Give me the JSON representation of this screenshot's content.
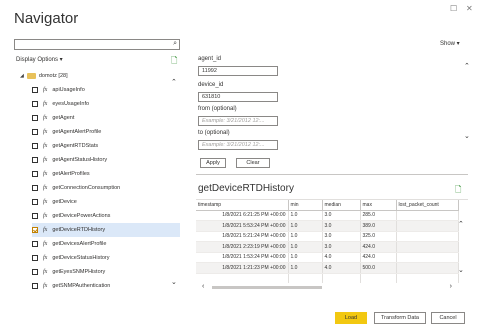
{
  "window": {
    "title": "Navigator",
    "maximize_glyph": "☐",
    "close_glyph": "✕"
  },
  "left": {
    "search": {
      "value": "",
      "placeholder": ""
    },
    "display_options": "Display Options ▾",
    "root": {
      "label": "domotz [28]",
      "icon": "folder-icon"
    },
    "items": [
      {
        "label": "apiUsageInfo",
        "checked": false
      },
      {
        "label": "eyesUsageInfo",
        "checked": false
      },
      {
        "label": "getAgent",
        "checked": false
      },
      {
        "label": "getAgentAlertProfile",
        "checked": false
      },
      {
        "label": "getAgentRTDStats",
        "checked": false
      },
      {
        "label": "getAgentStatusHistory",
        "checked": false
      },
      {
        "label": "getAlertProfiles",
        "checked": false
      },
      {
        "label": "getConnectionConsumption",
        "checked": false
      },
      {
        "label": "getDevice",
        "checked": false
      },
      {
        "label": "getDevicePowerActions",
        "checked": false
      },
      {
        "label": "getDeviceRTDHistory",
        "checked": true
      },
      {
        "label": "getDevicesAlertProfile",
        "checked": false
      },
      {
        "label": "getDeviceStatusHistory",
        "checked": false
      },
      {
        "label": "getEyesSNMPHistory",
        "checked": false
      },
      {
        "label": "getSNMPAuthentication",
        "checked": false
      }
    ]
  },
  "params": {
    "show_label": "Show ▾",
    "agent_id_label": "agent_id",
    "agent_id_value": "11992",
    "device_id_label": "device_id",
    "device_id_value": "631810",
    "from_label": "from (optional)",
    "from_placeholder": "Example: 3/21/2012 12:...",
    "to_label": "to (optional)",
    "to_placeholder": "Example: 3/21/2012 12:...",
    "apply": "Apply",
    "clear": "Clear"
  },
  "preview": {
    "title": "getDeviceRTDHistory",
    "columns": [
      "timestamp",
      "min",
      "median",
      "max",
      "lost_packet_count"
    ],
    "rows": [
      [
        "1/8/2021 6:21:25 PM +00:00",
        "1.0",
        "3.0",
        "285.0",
        ""
      ],
      [
        "1/8/2021 5:53:24 PM +00:00",
        "1.0",
        "3.0",
        "389.0",
        ""
      ],
      [
        "1/8/2021 5:21:24 PM +00:00",
        "1.0",
        "3.0",
        "325.0",
        ""
      ],
      [
        "1/8/2021 2:23:19 PM +00:00",
        "1.0",
        "3.0",
        "424.0",
        ""
      ],
      [
        "1/8/2021 1:53:24 PM +00:00",
        "1.0",
        "4.0",
        "424.0",
        ""
      ],
      [
        "1/8/2021 1:21:23 PM +00:00",
        "1.0",
        "4.0",
        "500.0",
        ""
      ],
      [
        "",
        "",
        "",
        "",
        ""
      ]
    ]
  },
  "footer": {
    "load": "Load",
    "transform": "Transform Data",
    "cancel": "Cancel"
  }
}
